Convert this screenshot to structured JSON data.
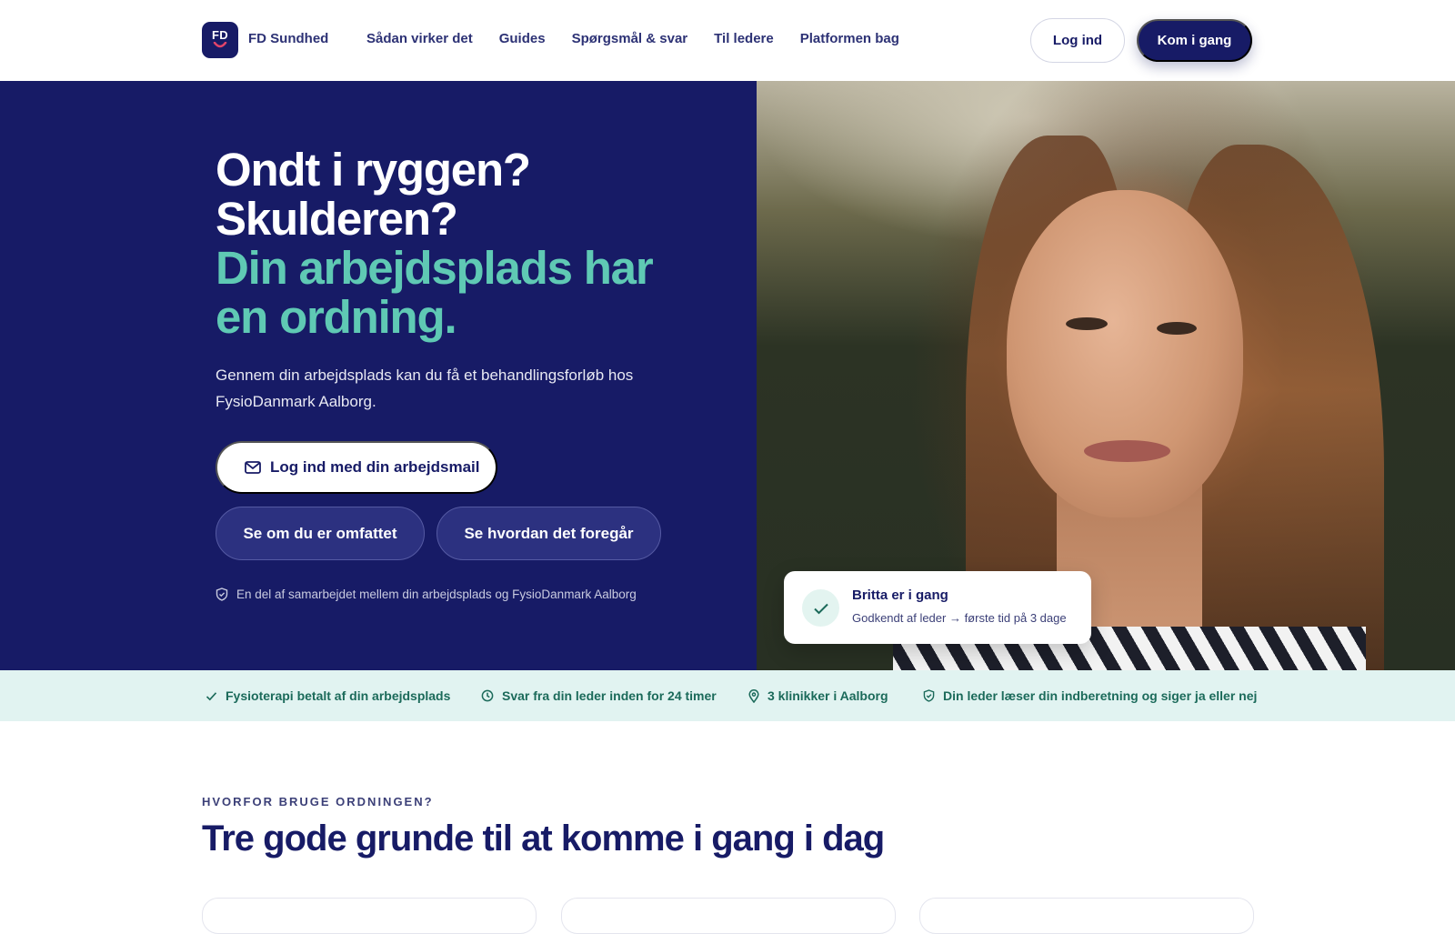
{
  "header": {
    "logo_text": "FD",
    "brand": "FD Sundhed",
    "nav": [
      "Sådan virker det",
      "Guides",
      "Spørgsmål & svar",
      "Til ledere",
      "Platformen bag"
    ],
    "login_label": "Log ind",
    "start_label": "Kom i gang"
  },
  "hero": {
    "title_line1": "Ondt i ryggen?",
    "title_line2": "Skulderen?",
    "title_line3": "Din arbejdsplads har",
    "title_line4": "en ordning.",
    "subtitle": "Gennem din arbejdsplads kan du få et behandlingsforløb hos FysioDanmark Aalborg.",
    "mail_button": "Log ind med din arbejdsmail",
    "covered_button": "Se om du er omfattet",
    "how_button": "Se hvordan det foregår",
    "trust_text": "En del af samarbejdet mellem din arbejdsplads og FysioDanmark Aalborg"
  },
  "status_card": {
    "title": "Britta er i gang",
    "text": "Godkendt af leder → første tid på 3 dage"
  },
  "benefits": [
    {
      "icon": "check-icon",
      "label": "Fysioterapi betalt af din arbejdsplads"
    },
    {
      "icon": "clock-icon",
      "label": "Svar fra din leder inden for 24 timer"
    },
    {
      "icon": "location-pin-icon",
      "label": "3 klinikker i Aalborg"
    },
    {
      "icon": "shield-icon",
      "label": "Din leder læser din indberetning og siger ja eller nej"
    }
  ],
  "reasons": {
    "kicker": "HVORFOR BRUGE ORDNINGEN?",
    "title": "Tre gode grunde til at komme i gang i dag"
  },
  "colors": {
    "navy": "#171b66",
    "teal": "#5fc9b4",
    "strip_bg": "#e1f3f1",
    "strip_text": "#1b6a5a"
  }
}
